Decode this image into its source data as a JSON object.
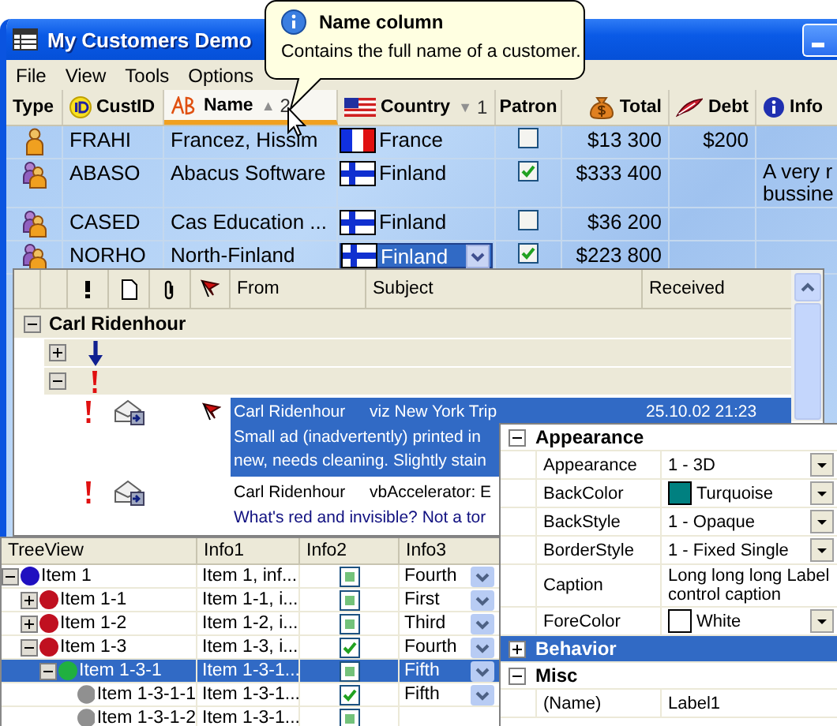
{
  "tooltip": {
    "title": "Name column",
    "text": "Contains the full name of a customer."
  },
  "window": {
    "title": "My Customers Demo"
  },
  "menu": [
    {
      "label": "File"
    },
    {
      "label": "View"
    },
    {
      "label": "Tools"
    },
    {
      "label": "Options"
    }
  ],
  "customers": {
    "columns": [
      {
        "label": "Type",
        "hot": false
      },
      {
        "label": "CustID",
        "hot": false
      },
      {
        "label": "Name",
        "sort": "▲",
        "sort_rank": "2",
        "hot": true
      },
      {
        "label": "Country",
        "sort": "▼",
        "sort_rank": "1",
        "hot": false
      },
      {
        "label": "Patron",
        "hot": false
      },
      {
        "label": "Total",
        "hot": false
      },
      {
        "label": "Debt",
        "hot": false
      },
      {
        "label": "Info",
        "hot": false
      }
    ],
    "rows": [
      {
        "kind": "person",
        "cust_id": "FRAHI",
        "name": "Francez, Hissim",
        "country": {
          "name": "France",
          "kind": "france"
        },
        "editing": false,
        "patron": false,
        "total": "$13 300",
        "debt": "$200"
      },
      {
        "kind": "group",
        "cust_id": "ABASO",
        "name": "Abacus Software",
        "country": {
          "name": "Finland",
          "kind": "finland"
        },
        "editing": false,
        "patron": true,
        "total": "$333 400",
        "info_lines": [
          "A very r",
          "bussine"
        ]
      },
      {
        "kind": "group",
        "cust_id": "CASED",
        "name": "Cas Education ...",
        "country": {
          "name": "Finland",
          "kind": "finland"
        },
        "editing": false,
        "patron": false,
        "total": "$36 200"
      },
      {
        "kind": "group",
        "cust_id": "NORHO",
        "name": "North-Finland",
        "country": {
          "name": "Finland",
          "kind": "finland"
        },
        "editing": true,
        "patron": true,
        "total": "$223 800"
      }
    ]
  },
  "mail": {
    "columns": [
      {
        "label": "From"
      },
      {
        "label": "Subject"
      },
      {
        "label": "Received"
      }
    ],
    "groups": [
      {
        "label": "Carl Ridenhour",
        "expanded": true,
        "subgroups": [
          {
            "kind": "low",
            "expanded": false
          },
          {
            "kind": "high",
            "expanded": true,
            "messages": [
              {
                "kind": "high",
                "flagged": true,
                "selected": true,
                "from": "Carl Ridenhour",
                "subject": "viz New York Trip",
                "received": "25.10.02 21:23",
                "preview": [
                  "Small ad (inadvertently) printed in",
                  "new, needs cleaning.  Slightly stain"
                ]
              },
              {
                "kind": "high",
                "flagged": false,
                "selected": false,
                "from": "Carl Ridenhour",
                "subject": "vbAccelerator: E",
                "preview": [
                  "What's red and invisible?  Not a tor"
                ]
              }
            ]
          }
        ]
      }
    ]
  },
  "tree": {
    "columns": [
      {
        "label": "TreeView"
      },
      {
        "label": "Info1"
      },
      {
        "label": "Info2"
      },
      {
        "label": "Info3"
      }
    ],
    "rows": [
      {
        "label": "Item 1",
        "color": "#2010c0",
        "expanded": true,
        "selected": false,
        "info1": "Item 1, inf...",
        "info2": false,
        "info3": "Fourth",
        "children": [
          {
            "label": "Item 1-1",
            "color": "#c01020",
            "expanded": false,
            "selected": false,
            "info1": "Item 1-1, i...",
            "info2": false,
            "info3": "First"
          },
          {
            "label": "Item 1-2",
            "color": "#c01020",
            "expanded": false,
            "selected": false,
            "info1": "Item 1-2, i...",
            "info2": false,
            "info3": "Third"
          },
          {
            "label": "Item 1-3",
            "color": "#c01020",
            "expanded": true,
            "selected": false,
            "info1": "Item 1-3, i...",
            "info2": true,
            "info3": "Fourth",
            "children": [
              {
                "label": "Item 1-3-1",
                "color": "#20b040",
                "expanded": true,
                "selected": true,
                "info1": "Item 1-3-1...",
                "info2": false,
                "info3": "Fifth",
                "children": [
                  {
                    "label": "Item 1-3-1-1",
                    "color": "#909090",
                    "selected": false,
                    "info1": "Item 1-3-1...",
                    "info2": true,
                    "info3": "Fifth"
                  },
                  {
                    "label": "Item 1-3-1-2",
                    "color": "#909090",
                    "selected": false,
                    "info1": "Item 1-3-1...",
                    "info2": false
                  }
                ]
              }
            ]
          }
        ]
      }
    ]
  },
  "properties": {
    "categories": [
      {
        "label": "Appearance",
        "expanded": true,
        "selected": false,
        "items": [
          {
            "name": "Appearance",
            "value": "1 - 3D",
            "kind": "dropdown"
          },
          {
            "name": "BackColor",
            "value": "Turquoise",
            "kind": "color",
            "color": "#008080"
          },
          {
            "name": "BackStyle",
            "value": "1 - Opaque",
            "kind": "dropdown"
          },
          {
            "name": "BorderStyle",
            "value": "1 - Fixed Single",
            "kind": "dropdown"
          },
          {
            "name": "Caption",
            "value": "Long long long Label control caption",
            "kind": "text"
          },
          {
            "name": "ForeColor",
            "value": "White",
            "kind": "color",
            "color": "#ffffff"
          }
        ]
      },
      {
        "label": "Behavior",
        "expanded": false,
        "selected": true
      },
      {
        "label": "Misc",
        "expanded": true,
        "selected": false,
        "items": [
          {
            "name": "(Name)",
            "value": "Label1",
            "kind": "text"
          }
        ]
      }
    ]
  }
}
